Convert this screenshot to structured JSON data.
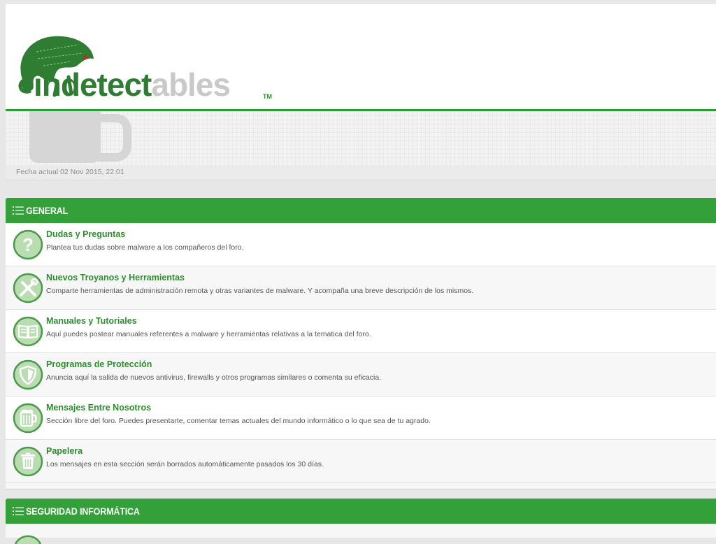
{
  "header": {
    "logo_text_part1": "indetect",
    "logo_text_part2": "ables",
    "logo_tm": "TM",
    "date_label": "Fecha actual 02 Nov 2015, 22:01"
  },
  "colors": {
    "brand_green": "#34a039",
    "link_green": "#2f8d30",
    "icon_bg": "#b9dcb0",
    "icon_border": "#4a9a4a"
  },
  "categories": [
    {
      "title": "GENERAL",
      "icon": "list-icon",
      "forums": [
        {
          "title": "Dudas y Preguntas",
          "description": "Plantea tus dudas sobre malware a los compañeros del foro.",
          "icon": "question-icon"
        },
        {
          "title": "Nuevos Troyanos y Herramientas",
          "description": "Comparte herramientas de administración remota y otras variantes de malware. Y acompaña una breve descripción de los mismos.",
          "icon": "tools-icon"
        },
        {
          "title": "Manuales y Tutoriales",
          "description": "Aquí puedes postear manuales referentes a malware y herramientas relativas a la tematica del foro.",
          "icon": "book-icon"
        },
        {
          "title": "Programas de Protección",
          "description": "Anuncia aquí la salida de nuevos antivirus, firewalls y otros programas similares o comenta su eficacia.",
          "icon": "shield-icon"
        },
        {
          "title": "Mensajes Entre Nosotros",
          "description": "Sección libre del foro. Puedes presentarte, comentar temas actuales del mundo informático o lo que sea de tu agrado.",
          "icon": "beer-mug-icon"
        },
        {
          "title": "Papelera",
          "description": "Los mensajes en esta sección serán borrados automáticamente pasados los 30 días.",
          "icon": "trash-icon"
        }
      ]
    },
    {
      "title": "SEGURIDAD INFORMÁTICA",
      "icon": "list-icon",
      "forums": []
    }
  ]
}
